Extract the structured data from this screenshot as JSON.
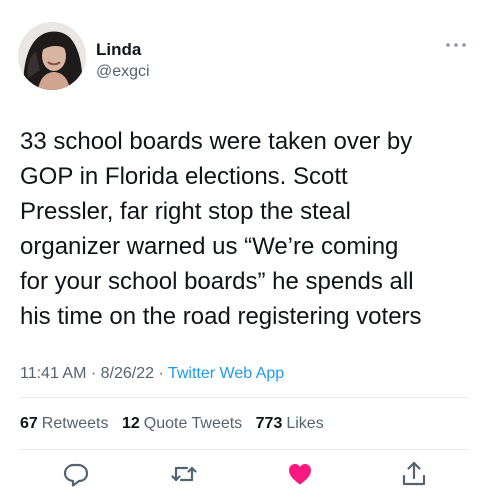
{
  "user": {
    "display_name": "Linda",
    "handle": "@exgci"
  },
  "tweet": {
    "lines": [
      "33 school boards were taken over by",
      "GOP in Florida elections. Scott",
      "Pressler, far right stop the steal",
      "organizer warned us “We’re coming",
      "for your school boards” he spends all",
      "his time on the road registering voters"
    ],
    "time": "11:41 AM",
    "separator": "·",
    "date": "8/26/22",
    "source": "Twitter Web App"
  },
  "stats": {
    "retweets_count": "67",
    "retweets_label": "Retweets",
    "quotes_count": "12",
    "quotes_label": "Quote Tweets",
    "likes_count": "773",
    "likes_label": "Likes"
  },
  "actions": {
    "reply_icon": "reply-icon",
    "retweet_icon": "retweet-icon",
    "like_icon": "heart-icon",
    "share_icon": "share-icon"
  },
  "colors": {
    "text": "#0f1419",
    "secondary": "#536471",
    "link": "#1d9bf0",
    "like": "#f91880"
  }
}
